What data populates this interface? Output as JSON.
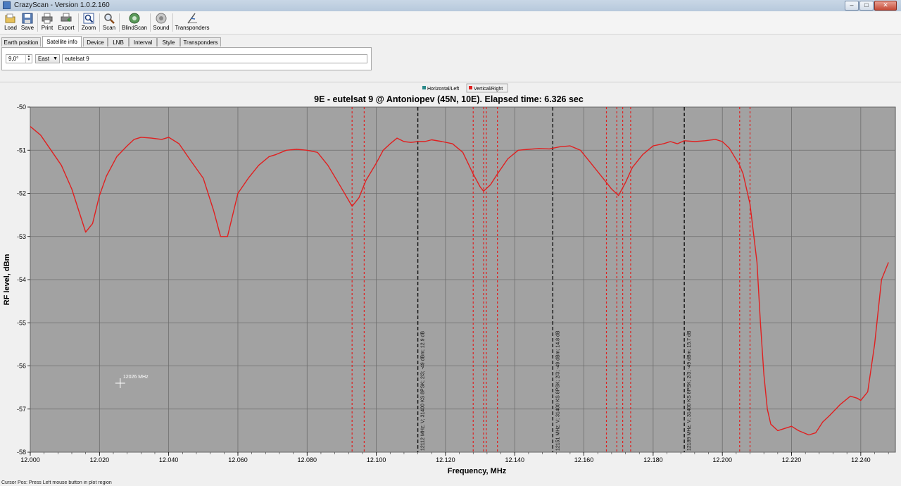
{
  "window": {
    "title": "CrazyScan - Version 1.0.2.160",
    "min_icon": "minimize-icon",
    "max_icon": "maximize-icon",
    "close_icon": "close-icon"
  },
  "toolbar": {
    "buttons": [
      {
        "label": "Load",
        "icon": "folder-open-icon"
      },
      {
        "label": "Save",
        "icon": "floppy-disk-icon"
      },
      {
        "label": "Print",
        "icon": "printer-icon"
      },
      {
        "label": "Export",
        "icon": "export-icon"
      },
      {
        "label": "Zoom",
        "icon": "zoom-icon"
      },
      {
        "label": "Scan",
        "icon": "scan-icon"
      },
      {
        "label": "BlindScan",
        "icon": "blindscan-icon"
      },
      {
        "label": "Sound",
        "icon": "sound-icon"
      },
      {
        "label": "Transponders",
        "icon": "transponders-icon"
      }
    ]
  },
  "tabs": [
    {
      "label": "Earth position",
      "active": false
    },
    {
      "label": "Satellite info",
      "active": true
    },
    {
      "label": "Device",
      "active": false
    },
    {
      "label": "LNB",
      "active": false
    },
    {
      "label": "Interval",
      "active": false
    },
    {
      "label": "Style",
      "active": false
    },
    {
      "label": "Transponders",
      "active": false
    }
  ],
  "satellite_info": {
    "position_value": "9,0°",
    "direction_value": "East",
    "name_value": "eutelsat 9"
  },
  "chart_data": {
    "type": "line",
    "title": "9E - eutelsat 9 @ Antoniopev (45N, 10E). Elapsed time: 6.326 sec",
    "xlabel": "Frequency, MHz",
    "ylabel": "RF level, dBm",
    "xlim": [
      12.0,
      12.25
    ],
    "ylim": [
      -58,
      -50
    ],
    "x_ticks": [
      "12.000",
      "12.020",
      "12.040",
      "12.060",
      "12.080",
      "12.100",
      "12.120",
      "12.140",
      "12.160",
      "12.180",
      "12.200",
      "12.220",
      "12.240"
    ],
    "y_ticks": [
      "-50",
      "-51",
      "-52",
      "-53",
      "-54",
      "-55",
      "-56",
      "-57",
      "-58"
    ],
    "grid": true,
    "legend": {
      "position": "top-center",
      "entries": [
        {
          "name": "Horizontal/Left",
          "color": "#2a8a8a"
        },
        {
          "name": "Vertical/Right",
          "color": "#e02020"
        }
      ]
    },
    "series": [
      {
        "name": "Vertical/Right",
        "color": "#e02020",
        "x": [
          12.0,
          12.003,
          12.006,
          12.009,
          12.012,
          12.016,
          12.018,
          12.02,
          12.022,
          12.025,
          12.028,
          12.03,
          12.032,
          12.035,
          12.038,
          12.04,
          12.043,
          12.046,
          12.05,
          12.053,
          12.055,
          12.057,
          12.06,
          12.063,
          12.066,
          12.069,
          12.071,
          12.074,
          12.077,
          12.08,
          12.083,
          12.086,
          12.089,
          12.093,
          12.095,
          12.097,
          12.1,
          12.102,
          12.104,
          12.106,
          12.108,
          12.11,
          12.112,
          12.114,
          12.116,
          12.119,
          12.122,
          12.125,
          12.128,
          12.13,
          12.131,
          12.133,
          12.135,
          12.138,
          12.141,
          12.144,
          12.147,
          12.15,
          12.153,
          12.156,
          12.159,
          12.162,
          12.166,
          12.168,
          12.17,
          12.172,
          12.174,
          12.177,
          12.18,
          12.183,
          12.185,
          12.187,
          12.189,
          12.192,
          12.195,
          12.198,
          12.2,
          12.202,
          12.205,
          12.206,
          12.208,
          12.21,
          12.211,
          12.212,
          12.213,
          12.214,
          12.216,
          12.218,
          12.22,
          12.222,
          12.225,
          12.227,
          12.229,
          12.231,
          12.234,
          12.237,
          12.239,
          12.24,
          12.242,
          12.244,
          12.246,
          12.248
        ],
        "y": [
          -50.45,
          -50.65,
          -51.0,
          -51.35,
          -51.9,
          -52.9,
          -52.7,
          -52.05,
          -51.6,
          -51.15,
          -50.9,
          -50.75,
          -50.7,
          -50.72,
          -50.75,
          -50.7,
          -50.85,
          -51.2,
          -51.65,
          -52.4,
          -53.0,
          -53.0,
          -52.0,
          -51.65,
          -51.35,
          -51.15,
          -51.1,
          -51.0,
          -50.98,
          -51.0,
          -51.05,
          -51.35,
          -51.75,
          -52.3,
          -52.1,
          -51.7,
          -51.3,
          -51.0,
          -50.85,
          -50.72,
          -50.8,
          -50.82,
          -50.8,
          -50.8,
          -50.76,
          -50.8,
          -50.85,
          -51.05,
          -51.55,
          -51.85,
          -51.95,
          -51.8,
          -51.55,
          -51.2,
          -51.0,
          -50.98,
          -50.96,
          -50.97,
          -50.92,
          -50.9,
          -51.0,
          -51.3,
          -51.7,
          -51.9,
          -52.05,
          -51.75,
          -51.4,
          -51.1,
          -50.9,
          -50.85,
          -50.8,
          -50.85,
          -50.78,
          -50.8,
          -50.78,
          -50.75,
          -50.8,
          -50.95,
          -51.35,
          -51.55,
          -52.25,
          -53.6,
          -55.0,
          -56.2,
          -57.0,
          -57.35,
          -57.5,
          -57.45,
          -57.4,
          -57.5,
          -57.6,
          -57.55,
          -57.3,
          -57.15,
          -56.9,
          -56.7,
          -56.75,
          -56.8,
          -56.6,
          -55.5,
          -54.0,
          -53.6
        ]
      }
    ],
    "transponder_markers": [
      {
        "freq": 12.112,
        "label": "12112 MHz; V; 31400 KS 8PSK; 2/3; -49 dBm; 12.9 dB"
      },
      {
        "freq": 12.151,
        "label": "12151 MHz; V; 31400 KS 8PSK; 2/3; -49 dBm; 14.8 dB"
      },
      {
        "freq": 12.189,
        "label": "12189 MHz; V; 31400 KS 8PSK; 2/3; -49 dBm; 15.7 dB"
      }
    ],
    "red_markers": [
      12.093,
      12.0965,
      12.128,
      12.131,
      12.1318,
      12.135,
      12.1665,
      12.1695,
      12.1712,
      12.1735,
      12.205,
      12.208
    ],
    "cursor": {
      "freq": 12.026,
      "level": -56.4,
      "label": "12026 MHz"
    }
  },
  "status": {
    "text": "Cursor Pos: Press Left mouse button in plot region"
  }
}
